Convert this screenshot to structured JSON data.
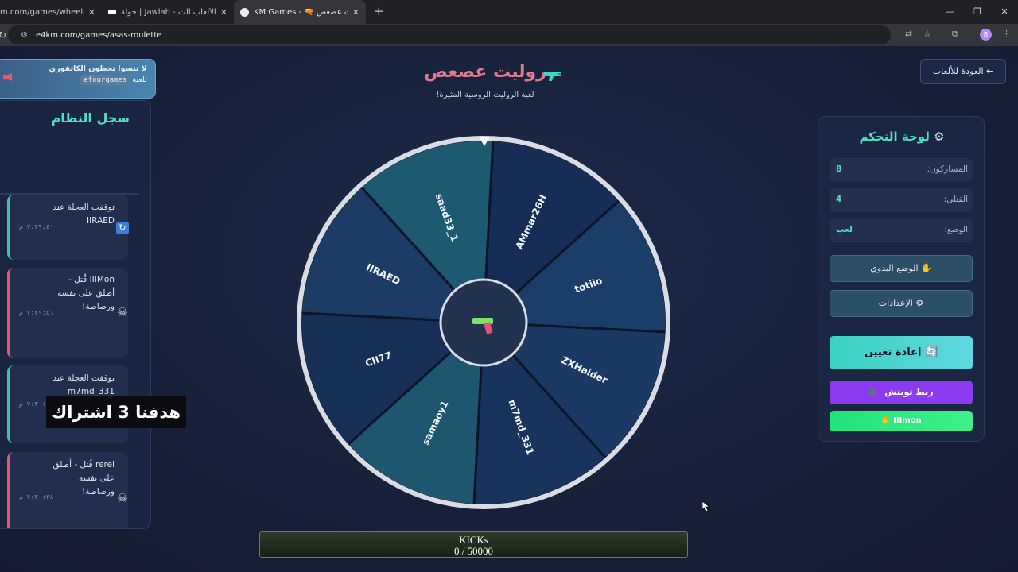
{
  "browser": {
    "tabs": [
      {
        "title": "m.com/games/wheel-of-fat",
        "active": false
      },
      {
        "title": "جولة | Jawlah - منصة الألعاب الت",
        "active": false
      },
      {
        "title": "KM Games - 🔫 روليت عصعص",
        "active": true
      }
    ],
    "url": "e4km.com/games/asas-roulette",
    "profile_initial": "B"
  },
  "promo": {
    "line1": "لا تنسوا تحطون الكاتقوري",
    "code": "efourgames",
    "line2": "للعبة"
  },
  "log": {
    "title": "سجل النظام",
    "entries": [
      {
        "type": "spin",
        "text": "توقفت العجلة عند IIRAED",
        "time": "٧:٢٩:٤٠ م"
      },
      {
        "type": "kill",
        "text": "IIIMon قُتل - أطلق على نفسه ورصاصة!",
        "time": "٧:٢٩:٥٦ م"
      },
      {
        "type": "spin",
        "text": "توقفت العجلة عند m7md_331",
        "time": "٧:٣٠:١٤ م"
      },
      {
        "type": "kill",
        "text": "rerel قُتل - أطلق على نفسه ورصاصة!",
        "time": "٧:٣٠:٣٨ م"
      }
    ]
  },
  "overlay_caption": "هدفنا 3 اشتراك",
  "game": {
    "title": "روليت عصعص",
    "subtitle": "لعبة الروليت الروسية المثيرة!",
    "back_label": "← العودة للألعاب"
  },
  "wheel": {
    "names": [
      "IIRAED",
      "saad33_1",
      "AMmar26H",
      "totiio",
      "ZXHaider",
      "m7md_331",
      "samaoy1",
      "CII77"
    ],
    "colors": [
      "#1c3c66",
      "#1d5a72",
      "#162e55",
      "#1b3e69",
      "#1b3a63",
      "#18345d",
      "#1f566f",
      "#163057"
    ]
  },
  "control_panel": {
    "title": "لوحة التحكم",
    "stats": [
      {
        "label": "المشاركون:",
        "value": "8"
      },
      {
        "label": "القتلى:",
        "value": "4"
      },
      {
        "label": "الوضع:",
        "value": "لعب"
      }
    ],
    "manual_label": "✋ الوضع اليدوي",
    "settings_label": "⚙ الإعدادات",
    "reset_label": "🔄 إعادة تعيين",
    "twitch_label": "ربط تويتش",
    "user_label": "IIImon ✋"
  },
  "kicks": {
    "label": "KICKs",
    "progress": "0 / 50000",
    "fraction": 0
  },
  "colors": {
    "accent_teal": "#4fe0c8",
    "title_pink": "#e2788c",
    "twitch_purple": "#8c3cf0",
    "green": "#23e27a"
  }
}
